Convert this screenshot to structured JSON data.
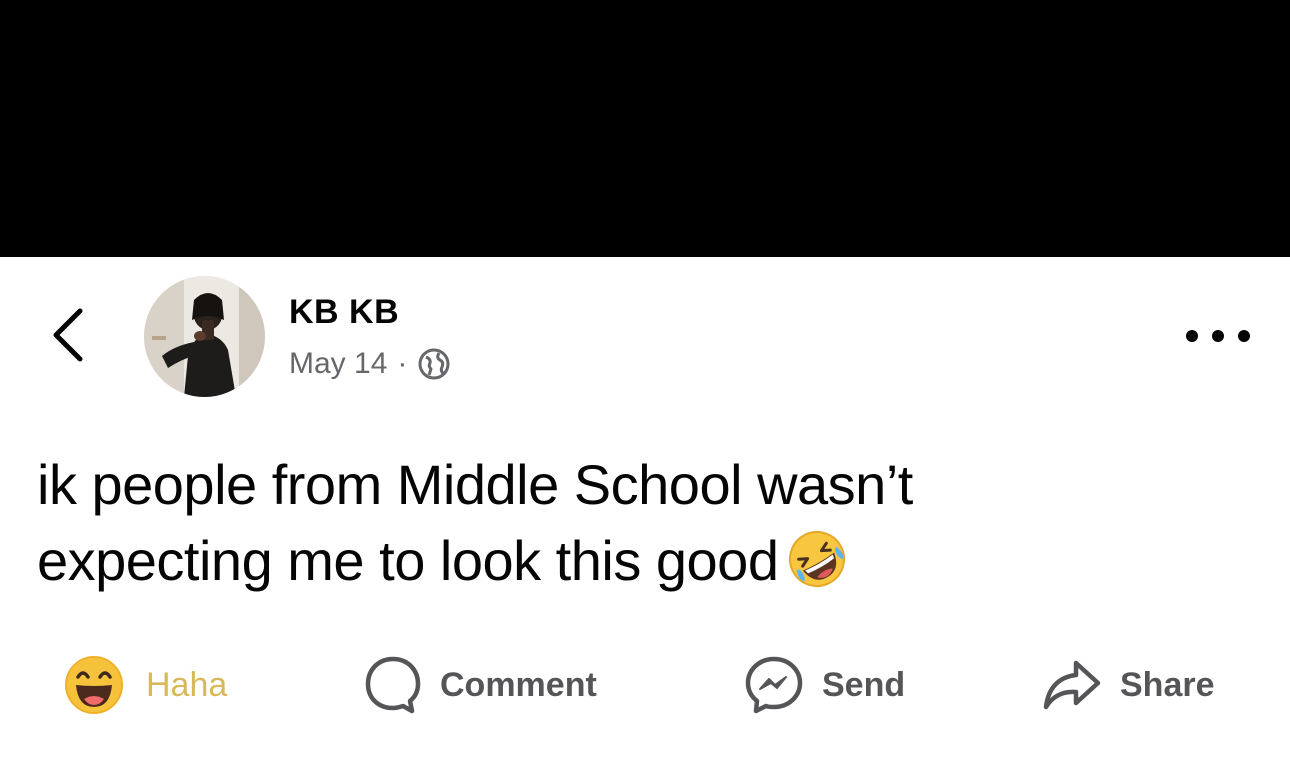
{
  "post": {
    "author": "KB KB",
    "date": "May 14",
    "separator": "·",
    "visibility_icon": "globe-icon",
    "text_line1": "ik people from Middle School wasn’t",
    "text_line2": "expecting me to look this good",
    "emoji": "rolling-on-floor-laughing-emoji"
  },
  "actions": {
    "haha_label": "Haha",
    "comment_label": "Comment",
    "send_label": "Send",
    "share_label": "Share"
  },
  "colors": {
    "header_bg": "#000000",
    "text": "#050505",
    "meta": "#65676b",
    "action": "#555558",
    "haha": "#d8b95a"
  }
}
